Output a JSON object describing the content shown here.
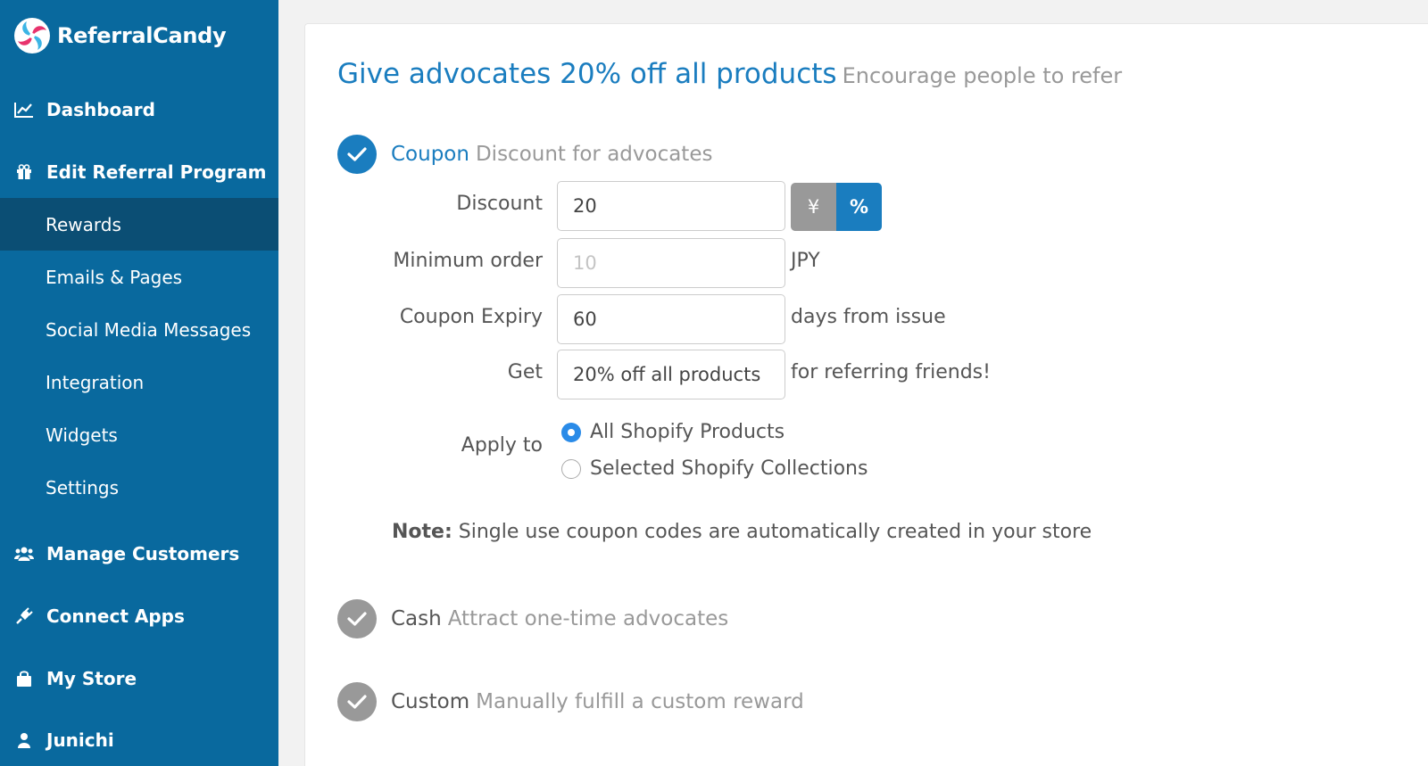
{
  "brand": {
    "name": "ReferralCandy",
    "logo_icon": "candy-swirl-logo"
  },
  "sidebar": {
    "dashboard": {
      "label": "Dashboard",
      "icon": "line-chart-icon"
    },
    "edit_program": {
      "label": "Edit Referral Program",
      "icon": "gift-icon"
    },
    "sub_items": [
      {
        "label": "Rewards",
        "active": true
      },
      {
        "label": "Emails & Pages"
      },
      {
        "label": "Social Media Messages"
      },
      {
        "label": "Integration"
      },
      {
        "label": "Widgets"
      },
      {
        "label": "Settings"
      }
    ],
    "manage_customers": {
      "label": "Manage Customers",
      "icon": "users-icon"
    },
    "connect_apps": {
      "label": "Connect Apps",
      "icon": "plug-icon"
    },
    "my_store": {
      "label": "My Store",
      "icon": "shopping-bag-icon"
    },
    "user": {
      "label": "Junichi",
      "icon": "user-icon"
    }
  },
  "page": {
    "title": "Give advocates 20% off all products",
    "subtitle": "Encourage people to refer"
  },
  "coupon": {
    "name": "Coupon",
    "desc": "Discount for advocates",
    "discount_label": "Discount",
    "discount_value": "20",
    "unit_yen": "¥",
    "unit_percent": "%",
    "min_order_label": "Minimum order",
    "min_order_placeholder": "10",
    "min_order_unit": "JPY",
    "expiry_label": "Coupon Expiry",
    "expiry_value": "60",
    "expiry_suffix": "days from issue",
    "get_label": "Get",
    "get_value": "20% off all products",
    "get_suffix": "for referring friends!",
    "apply_label": "Apply to",
    "apply_options": [
      "All Shopify Products",
      "Selected Shopify Collections"
    ],
    "note_bold": "Note:",
    "note_text": "Single use coupon codes are automatically created in your store"
  },
  "cash": {
    "name": "Cash",
    "desc": "Attract one-time advocates"
  },
  "custom": {
    "name": "Custom",
    "desc": "Manually fulfill a custom reward"
  },
  "colors": {
    "sidebar": "#09699e",
    "sidebar_active": "#0b4e74",
    "accent": "#1a7dbf",
    "muted": "#999999"
  }
}
